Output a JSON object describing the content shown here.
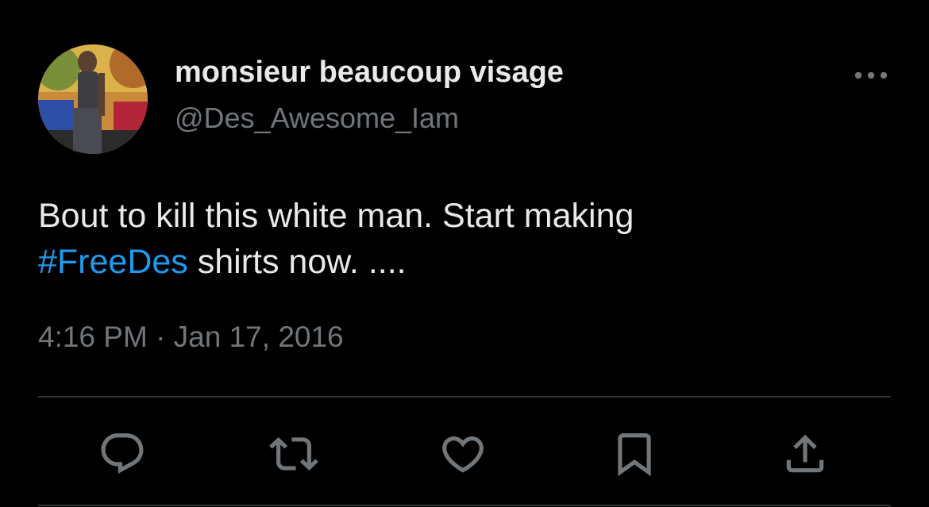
{
  "author": {
    "display_name": "monsieur beaucoup visage",
    "handle": "@Des_Awesome_Iam"
  },
  "tweet": {
    "text_line1": "Bout to kill this white man. Start making",
    "hashtag": "#FreeDes",
    "text_rest": " shirts now. ....",
    "timestamp": "4:16 PM · Jan 17, 2016"
  },
  "actions": [
    {
      "name": "reply",
      "icon": "reply-icon"
    },
    {
      "name": "retweet",
      "icon": "retweet-icon"
    },
    {
      "name": "like",
      "icon": "heart-icon"
    },
    {
      "name": "bookmark",
      "icon": "bookmark-icon"
    },
    {
      "name": "share",
      "icon": "share-icon"
    }
  ],
  "colors": {
    "background": "#000000",
    "text": "#e7e9ea",
    "secondary": "#71767b",
    "link": "#1d9bf0",
    "divider": "#2f3336"
  }
}
